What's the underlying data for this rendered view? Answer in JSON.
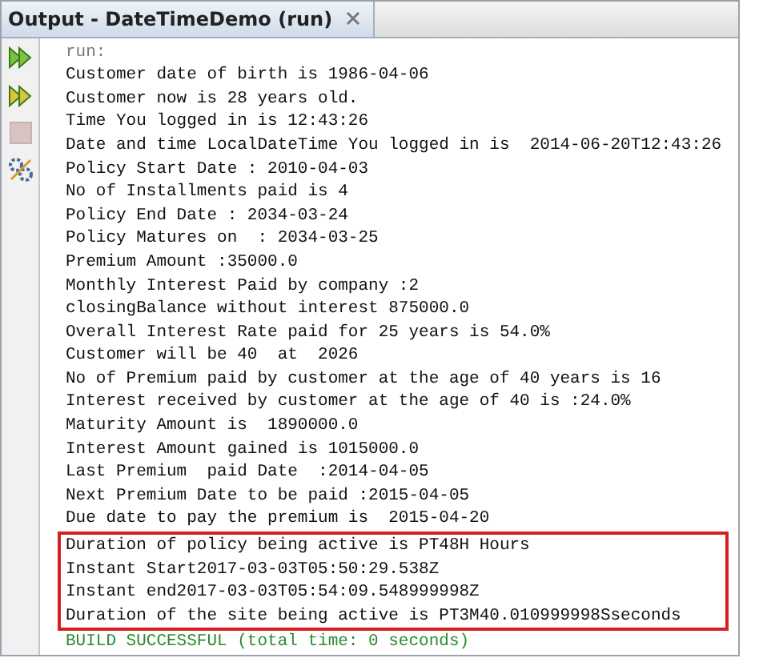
{
  "tab": {
    "title": "Output - DateTimeDemo (run)",
    "selected": true
  },
  "toolbar": [
    {
      "kind": "rerun",
      "disabled": false
    },
    {
      "kind": "rerun-params",
      "disabled": false
    },
    {
      "kind": "stop",
      "disabled": true
    },
    {
      "kind": "settings",
      "disabled": false
    }
  ],
  "output": {
    "lines": [
      {
        "kind": "info",
        "text": "run:"
      },
      {
        "kind": "output",
        "text": "Customer date of birth is 1986-04-06"
      },
      {
        "kind": "output",
        "text": "Customer now is 28 years old."
      },
      {
        "kind": "output",
        "text": "Time You logged in is 12:43:26"
      },
      {
        "kind": "output",
        "text": "Date and time LocalDateTime You logged in is  2014-06-20T12:43:26"
      },
      {
        "kind": "output",
        "text": "Policy Start Date : 2010-04-03"
      },
      {
        "kind": "output",
        "text": "No of Installments paid is 4"
      },
      {
        "kind": "output",
        "text": "Policy End Date : 2034-03-24"
      },
      {
        "kind": "output",
        "text": "Policy Matures on  : 2034-03-25"
      },
      {
        "kind": "output",
        "text": "Premium Amount :35000.0"
      },
      {
        "kind": "output",
        "text": "Monthly Interest Paid by company :2"
      },
      {
        "kind": "output",
        "text": "closingBalance without interest 875000.0"
      },
      {
        "kind": "output",
        "text": "Overall Interest Rate paid for 25 years is 54.0%"
      },
      {
        "kind": "output",
        "text": "Customer will be 40  at  2026"
      },
      {
        "kind": "output",
        "text": "No of Premium paid by customer at the age of 40 years is 16"
      },
      {
        "kind": "output",
        "text": "Interest received by customer at the age of 40 is :24.0%"
      },
      {
        "kind": "output",
        "text": "Maturity Amount is  1890000.0"
      },
      {
        "kind": "output",
        "text": "Interest Amount gained is 1015000.0"
      },
      {
        "kind": "output",
        "text": "Last Premium  paid Date  :2014-04-05"
      },
      {
        "kind": "output",
        "text": "Next Premium Date to be paid :2015-04-05"
      },
      {
        "kind": "output",
        "text": "Due date to pay the premium is  2015-04-20"
      }
    ],
    "highlighted": [
      "Duration of policy being active is PT48H Hours",
      "Instant Start2017-03-03T05:50:29.538Z",
      "Instant end2017-03-03T05:54:09.548999998Z",
      "Duration of the site being active is PT3M40.010999998Sseconds"
    ],
    "after": [
      {
        "kind": "success",
        "text": "BUILD SUCCESSFUL (total time: 0 seconds)"
      }
    ]
  }
}
